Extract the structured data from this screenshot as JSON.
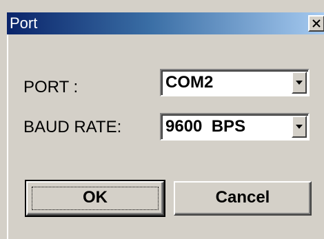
{
  "window": {
    "title": "Port",
    "close_symbol": "X"
  },
  "form": {
    "port_label": "PORT :",
    "port_value": "COM2",
    "baud_label": "BAUD RATE:",
    "baud_value": "9600  BPS"
  },
  "buttons": {
    "ok_label": "OK",
    "cancel_label": "Cancel"
  },
  "icons": {
    "close": "close-icon",
    "dropdown": "chevron-down-icon"
  },
  "colors": {
    "titlebar_start": "#0a246a",
    "titlebar_end": "#a6caf0",
    "dialog_background": "#d4d0c8"
  }
}
